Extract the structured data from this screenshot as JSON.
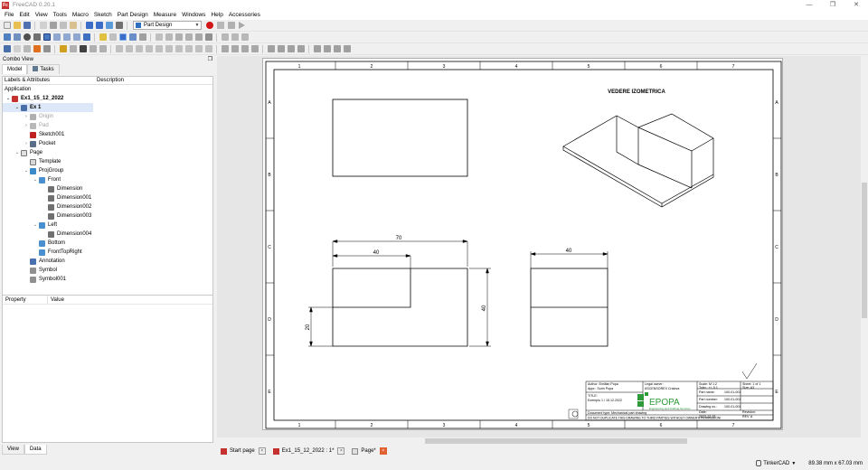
{
  "window": {
    "title": "FreeCAD 0.20.1",
    "app_icon": "Fc"
  },
  "menu": [
    "File",
    "Edit",
    "View",
    "Tools",
    "Macro",
    "Sketch",
    "Part Design",
    "Measure",
    "Windows",
    "Help",
    "Accessories"
  ],
  "toolbar": {
    "workbench": "Part Design"
  },
  "combo_view": {
    "title": "Combo View",
    "tabs": [
      "Model",
      "Tasks"
    ],
    "tree_columns": [
      "Labels & Attributes",
      "Description"
    ],
    "tree_root": "Application",
    "tree": [
      {
        "label": "Ex1_15_12_2022",
        "level": 0,
        "twist": "v",
        "icon": "document-icon",
        "bold": true
      },
      {
        "label": "Ex 1",
        "level": 1,
        "twist": "v",
        "icon": "body-icon",
        "bold": true,
        "selected": true
      },
      {
        "label": "Origin",
        "level": 2,
        "twist": ">",
        "icon": "origin-icon",
        "dim": true
      },
      {
        "label": "Pad",
        "level": 2,
        "twist": ">",
        "icon": "pad-icon",
        "dim": true
      },
      {
        "label": "Sketch001",
        "level": 2,
        "twist": "",
        "icon": "sketch-icon"
      },
      {
        "label": "Pocket",
        "level": 2,
        "twist": ">",
        "icon": "pocket-icon"
      },
      {
        "label": "Page",
        "level": 1,
        "twist": "v",
        "icon": "page-icon"
      },
      {
        "label": "Template",
        "level": 2,
        "twist": "",
        "icon": "template-icon"
      },
      {
        "label": "ProjGroup",
        "level": 2,
        "twist": "v",
        "icon": "projgroup-icon"
      },
      {
        "label": "Front",
        "level": 3,
        "twist": "v",
        "icon": "view-icon"
      },
      {
        "label": "Dimension",
        "level": 4,
        "twist": "",
        "icon": "hdim-icon"
      },
      {
        "label": "Dimension001",
        "level": 4,
        "twist": "",
        "icon": "hdim-icon"
      },
      {
        "label": "Dimension002",
        "level": 4,
        "twist": "",
        "icon": "vdim-icon"
      },
      {
        "label": "Dimension003",
        "level": 4,
        "twist": "",
        "icon": "vdim-icon"
      },
      {
        "label": "Left",
        "level": 3,
        "twist": "v",
        "icon": "view-icon"
      },
      {
        "label": "Dimension004",
        "level": 4,
        "twist": "",
        "icon": "hdim-icon"
      },
      {
        "label": "Bottom",
        "level": 3,
        "twist": "",
        "icon": "view-icon"
      },
      {
        "label": "FrontTopRight",
        "level": 3,
        "twist": "",
        "icon": "view-icon"
      },
      {
        "label": "Annotation",
        "level": 2,
        "twist": "",
        "icon": "annotation-icon"
      },
      {
        "label": "Symbol",
        "level": 2,
        "twist": "",
        "icon": "symbol-icon"
      },
      {
        "label": "Symbol001",
        "level": 2,
        "twist": "",
        "icon": "symbol-icon"
      }
    ],
    "property_columns": [
      "Property",
      "Value"
    ],
    "bottom_tabs": [
      "View",
      "Data"
    ]
  },
  "drawing": {
    "ruler_numbers": [
      "1",
      "2",
      "3",
      "4",
      "5",
      "6",
      "7"
    ],
    "ruler_letters": [
      "A",
      "B",
      "C",
      "D",
      "E"
    ],
    "iso_title": "VEDERE IZOMETRICA",
    "dim_70": "70",
    "dim_40_top": "40",
    "dim_40_right": "40",
    "dim_20": "20",
    "dim_40_left_view": "40",
    "title_block": {
      "author": "Author: Emilian Popa",
      "appr": "Appr.: Sorin Popa",
      "legal_owner": "Legal owner:",
      "company": "ASCENSOREX Craiova",
      "title_label": "TITLE:",
      "title_value": "Exemplu 1 / 15.12.2022",
      "logo_text": "EPOPA",
      "logo_sub": "Engineering and Drafting Services",
      "doc_type": "Document type:   Mechanical part drawing",
      "warning": "DO NOT DUPLICATE THIS DRAWING TO THIRD PARTIES WITHOUT OWNER'S PERMISSION!",
      "scale": "Scale: M 1:2",
      "toler": "Toler.: +/- 0.1",
      "sheet": "Sheet: 1 of 1",
      "size": "Size:     A3",
      "part_name": "Part name:",
      "part_name_val": "100-01-001",
      "part_number": "Part number:",
      "part_number_val": "100-01-001",
      "drawing_no": "Drawing no.:",
      "drawing_no_val": "100-01-001",
      "date_label": "Date:",
      "date_val": "2022-12-15",
      "revision_label": "Revision:",
      "revision_val": "REV. A"
    }
  },
  "mdi_tabs": [
    {
      "label": "Start page",
      "active": false
    },
    {
      "label": "Ex1_15_12_2022 : 1*",
      "active": false
    },
    {
      "label": "Page*",
      "active": true
    }
  ],
  "status": {
    "nav_style": "TinkerCAD",
    "dimensions": "89.38 mm x 67.03 mm"
  }
}
